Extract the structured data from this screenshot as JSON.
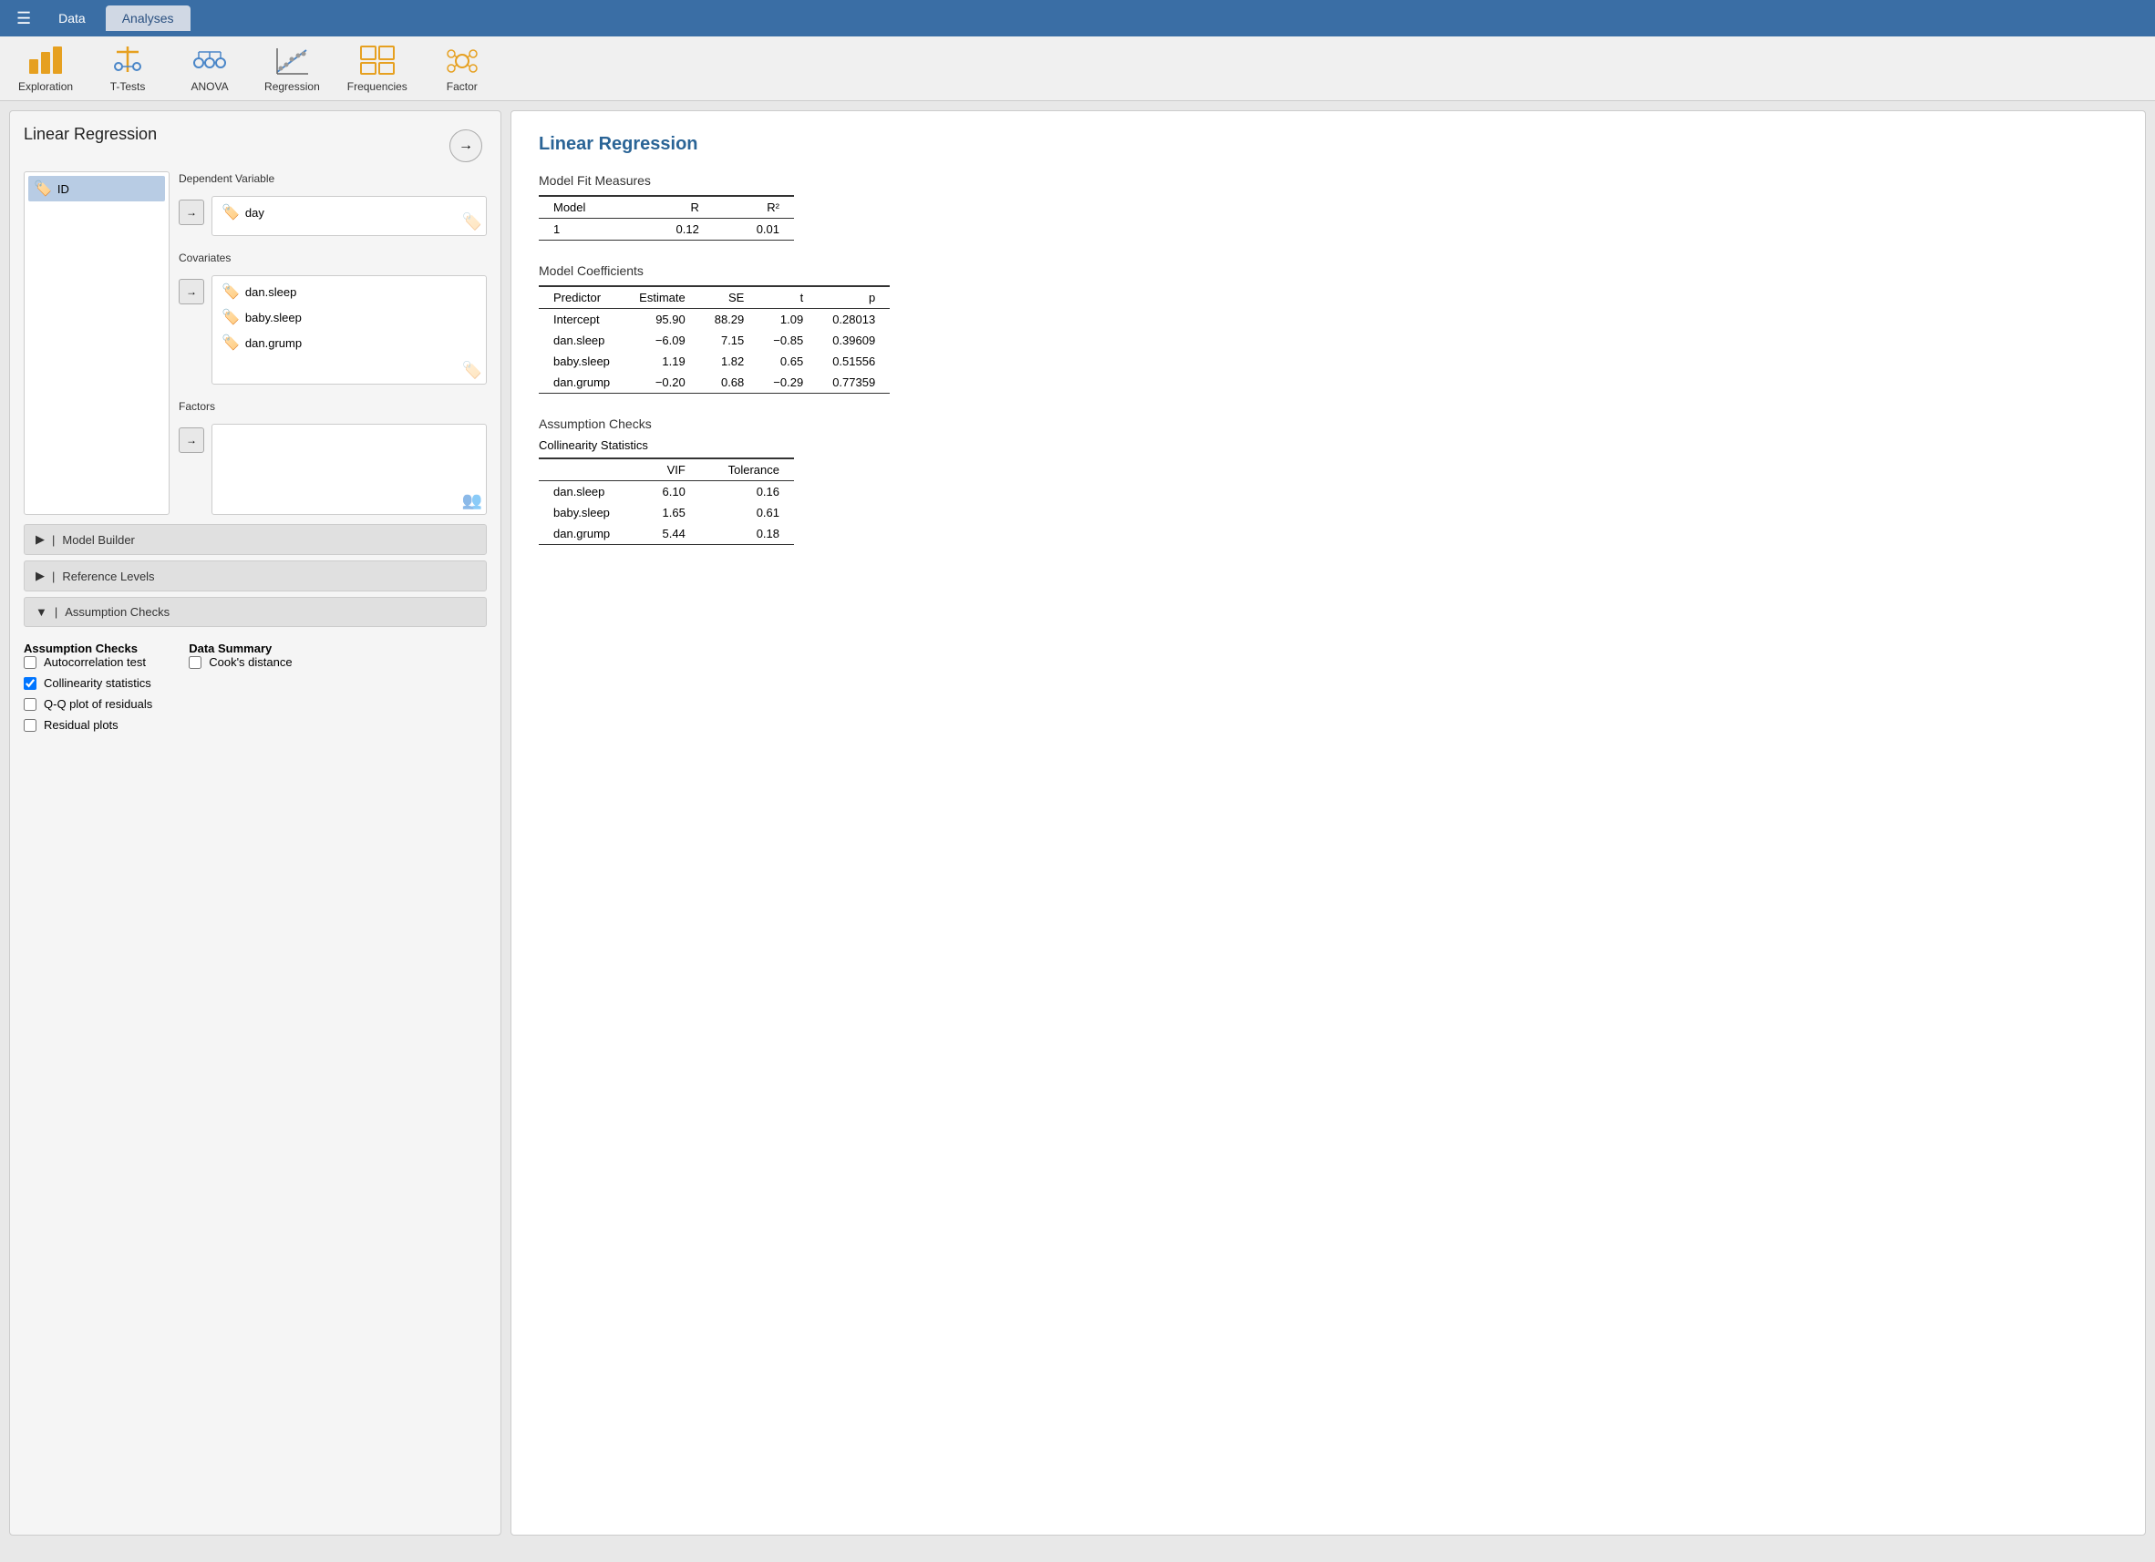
{
  "topbar": {
    "data_tab": "Data",
    "analyses_tab": "Analyses"
  },
  "toolbar": {
    "items": [
      {
        "label": "Exploration",
        "id": "exploration"
      },
      {
        "label": "T-Tests",
        "id": "ttests"
      },
      {
        "label": "ANOVA",
        "id": "anova"
      },
      {
        "label": "Regression",
        "id": "regression"
      },
      {
        "label": "Frequencies",
        "id": "frequencies"
      },
      {
        "label": "Factor",
        "id": "factor"
      }
    ]
  },
  "left_panel": {
    "title": "Linear Regression",
    "source_vars": [
      {
        "name": "ID"
      }
    ],
    "dependent_label": "Dependent Variable",
    "dependent_var": "day",
    "covariates_label": "Covariates",
    "covariates": [
      {
        "name": "dan.sleep"
      },
      {
        "name": "baby.sleep"
      },
      {
        "name": "dan.grump"
      }
    ],
    "factors_label": "Factors",
    "factors": [],
    "model_builder_label": "Model Builder",
    "reference_levels_label": "Reference Levels",
    "assumption_checks_label": "Assumption Checks",
    "assumption_checks": {
      "title": "Assumption Checks",
      "items": [
        {
          "label": "Autocorrelation test",
          "checked": false
        },
        {
          "label": "Collinearity statistics",
          "checked": true
        },
        {
          "label": "Q-Q plot of residuals",
          "checked": false
        },
        {
          "label": "Residual plots",
          "checked": false
        }
      ]
    },
    "data_summary": {
      "title": "Data Summary",
      "items": [
        {
          "label": "Cook's distance",
          "checked": false
        }
      ]
    }
  },
  "right_panel": {
    "title": "Linear Regression",
    "model_fit": {
      "section_title": "Model Fit Measures",
      "headers": [
        "Model",
        "R",
        "R²"
      ],
      "rows": [
        {
          "model": "1",
          "r": "0.12",
          "r2": "0.01"
        }
      ]
    },
    "model_coefficients": {
      "section_title": "Model Coefficients",
      "headers": [
        "Predictor",
        "Estimate",
        "SE",
        "t",
        "p"
      ],
      "rows": [
        {
          "predictor": "Intercept",
          "estimate": "95.90",
          "se": "88.29",
          "t": "1.09",
          "p": "0.28013"
        },
        {
          "predictor": "dan.sleep",
          "estimate": "−6.09",
          "se": "7.15",
          "t": "−0.85",
          "p": "0.39609"
        },
        {
          "predictor": "baby.sleep",
          "estimate": "1.19",
          "se": "1.82",
          "t": "0.65",
          "p": "0.51556"
        },
        {
          "predictor": "dan.grump",
          "estimate": "−0.20",
          "se": "0.68",
          "t": "−0.29",
          "p": "0.77359"
        }
      ]
    },
    "assumption_checks": {
      "section_title": "Assumption Checks",
      "collinearity": {
        "title": "Collinearity Statistics",
        "headers": [
          "",
          "VIF",
          "Tolerance"
        ],
        "rows": [
          {
            "predictor": "dan.sleep",
            "vif": "6.10",
            "tolerance": "0.16"
          },
          {
            "predictor": "baby.sleep",
            "vif": "1.65",
            "tolerance": "0.61"
          },
          {
            "predictor": "dan.grump",
            "vif": "5.44",
            "tolerance": "0.18"
          }
        ]
      }
    }
  }
}
